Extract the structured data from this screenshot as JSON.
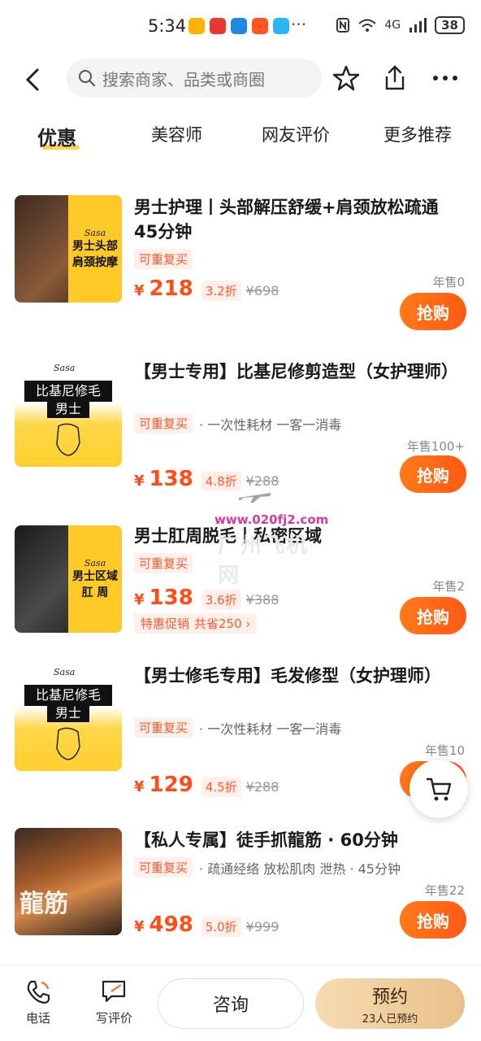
{
  "status_bar": {
    "time": "5:34",
    "more": "···",
    "network": "4G",
    "battery": "38"
  },
  "search": {
    "placeholder": "搜索商家、品类或商圈"
  },
  "tabs": [
    {
      "label": "优惠",
      "active": true
    },
    {
      "label": "美容师",
      "active": false
    },
    {
      "label": "网友评价",
      "active": false
    },
    {
      "label": "更多推荐",
      "active": false
    }
  ],
  "deals": [
    {
      "title": "男士护理丨头部解压舒缓+肩颈放松疏通45分钟",
      "tag": "可重复买",
      "extra": "",
      "price": "218",
      "discount": "3.2折",
      "original": "¥698",
      "sold": "年售0",
      "buy": "抢购",
      "thumb": {
        "brand": "Sasa",
        "line1": "男士头部",
        "line2": "肩颈按摩"
      }
    },
    {
      "title": "【男士专用】比基尼修剪造型（女护理师）",
      "tag": "可重复买",
      "extra": "· 一次性耗材 一客一消毒",
      "price": "138",
      "discount": "4.8折",
      "original": "¥288",
      "sold": "年售100+",
      "buy": "抢购",
      "thumb": {
        "brand": "Sasa",
        "line1": "比基尼修毛",
        "line2": "男士"
      }
    },
    {
      "title": "男士肛周脱毛丨私密区域",
      "tag": "可重复买",
      "extra": "",
      "price": "138",
      "discount": "3.6折",
      "original": "¥388",
      "sold": "年售2",
      "buy": "抢购",
      "promo": {
        "label": "特惠促销",
        "saving": "共省250 ›"
      },
      "thumb": {
        "brand": "Sasa",
        "line1": "男士区域",
        "line2": "肛 周"
      }
    },
    {
      "title": "【男士修毛专用】毛发修型（女护理师）",
      "tag": "可重复买",
      "extra": "· 一次性耗材 一客一消毒",
      "price": "129",
      "discount": "4.5折",
      "original": "¥288",
      "sold": "年售10",
      "buy": "抢购",
      "thumb": {
        "brand": "Sasa",
        "line1": "比基尼修毛",
        "line2": "男士"
      }
    },
    {
      "title": "【私人专属】徒手抓龍筋 · 60分钟",
      "tag": "可重复买",
      "extra": "· 疏通经络 放松肌肉 泄热 · 45分钟",
      "price": "498",
      "discount": "5.0折",
      "original": "¥999",
      "sold": "年售22",
      "buy": "抢购",
      "thumb": {
        "line1": "龍筋"
      }
    }
  ],
  "currency": "¥",
  "watermark": {
    "url": "www.020fj2.com",
    "name": "广州飞机网"
  },
  "bottom": {
    "phone": "电话",
    "review": "写评价",
    "consult": "咨询",
    "book": "预约",
    "book_sub": "23人已预约"
  },
  "colors": {
    "accent": "#ff5a14",
    "tab_underline": "#ffd34d",
    "book_gold": "#e9c08a"
  }
}
